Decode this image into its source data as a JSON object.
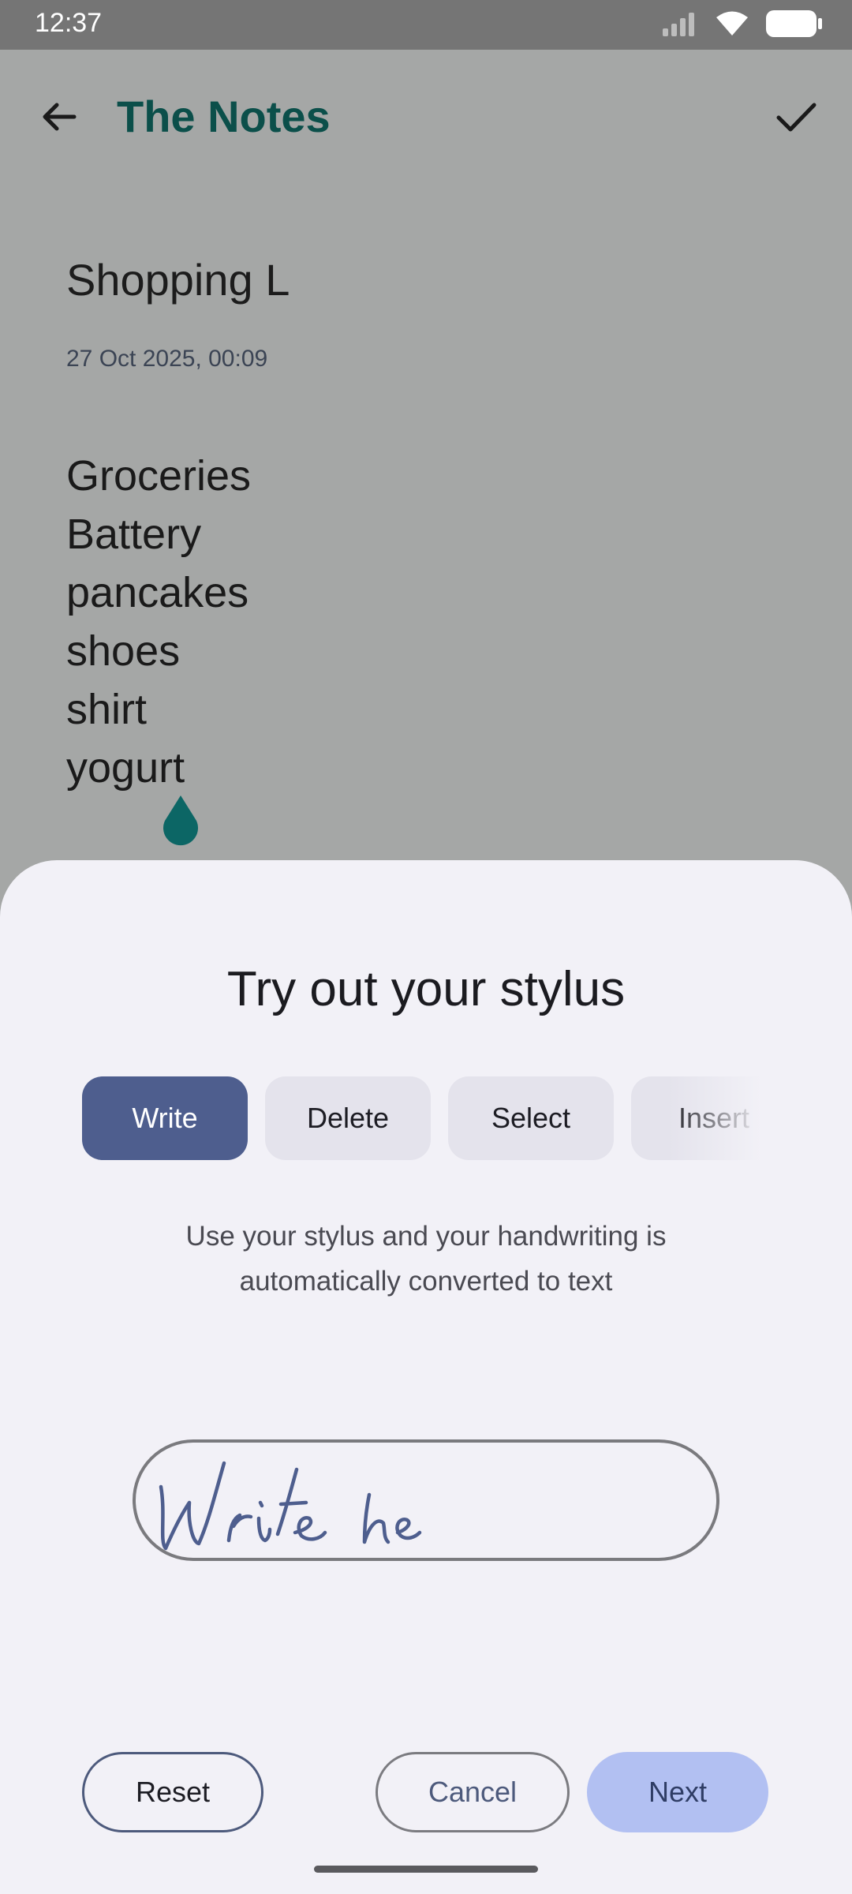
{
  "status_bar": {
    "time": "12:37",
    "icons": [
      "signal-icon",
      "wifi-icon",
      "battery-icon"
    ]
  },
  "app_bar": {
    "title": "The Notes",
    "back_icon": "arrow-back-icon",
    "confirm_icon": "check-icon"
  },
  "note": {
    "title": "Shopping L",
    "date": "27 Oct 2025, 00:09",
    "lines": [
      "Groceries",
      "Battery",
      "pancakes",
      "shoes",
      "shirt",
      "yogurt"
    ]
  },
  "stylus_sheet": {
    "title": "Try out your stylus",
    "tabs": [
      "Write",
      "Delete",
      "Select",
      "Insert"
    ],
    "active_tab": "Write",
    "description": "Use your stylus and your handwriting is automatically converted to text",
    "sample_handwriting": "Write he",
    "buttons": {
      "reset": "Reset",
      "cancel": "Cancel",
      "next": "Next"
    }
  },
  "colors": {
    "accent": "#0b4f4a",
    "active_chip": "#4e5e8e",
    "next_button": "#b2c0f2",
    "scrim": "#a5a7a6",
    "sheet_bg": "#f2f1f7"
  }
}
